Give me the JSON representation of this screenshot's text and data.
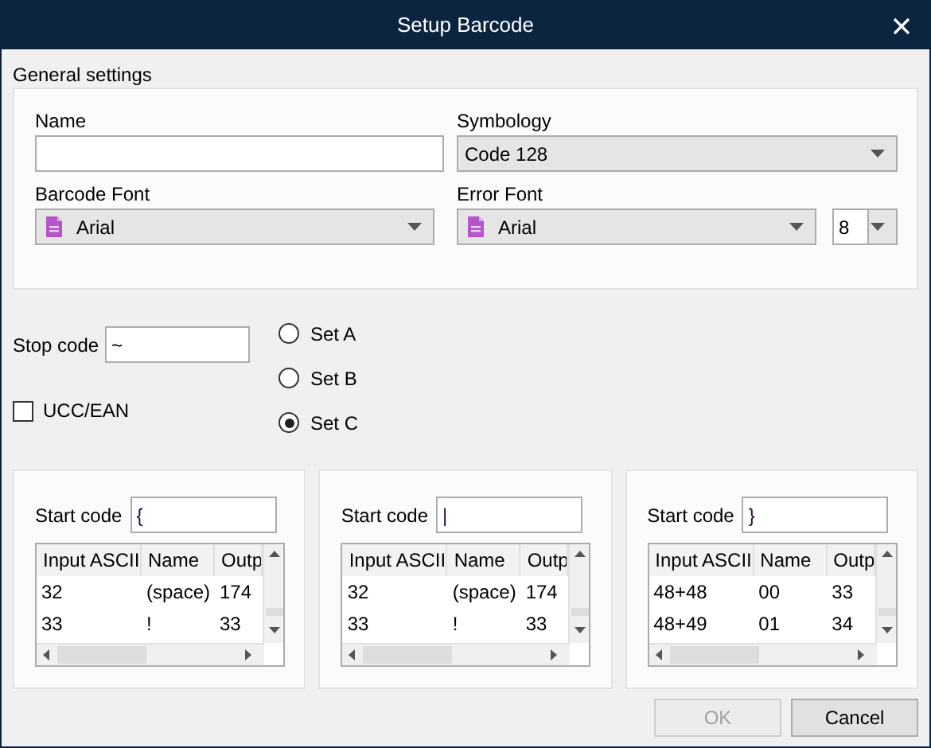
{
  "window": {
    "title": "Setup Barcode"
  },
  "general_settings": {
    "title": "General settings",
    "name": {
      "label": "Name"
    },
    "symbology": {
      "label": "Symbology",
      "value": "Code 128"
    },
    "barcode_font": {
      "label": "Barcode Font",
      "value": "Arial"
    },
    "error_font": {
      "label": "Error Font",
      "value": "Arial",
      "size": "8"
    }
  },
  "stop_code": {
    "label": "Stop code",
    "value": "~"
  },
  "sets": [
    {
      "label": "Set A",
      "selected": false
    },
    {
      "label": "Set B",
      "selected": false
    },
    {
      "label": "Set C",
      "selected": true
    }
  ],
  "ucc_ean": {
    "label": "UCC/EAN",
    "checked": false
  },
  "code_tables": [
    {
      "start_code_label": "Start code",
      "start_code": "{",
      "columns": [
        "Input ASCII",
        "Name",
        "Outp"
      ],
      "rows": [
        [
          "32",
          "(space)",
          "174"
        ],
        [
          "33",
          "!",
          "33"
        ]
      ]
    },
    {
      "start_code_label": "Start code",
      "start_code": "|",
      "columns": [
        "Input ASCII",
        "Name",
        "Outp"
      ],
      "rows": [
        [
          "32",
          "(space)",
          "174"
        ],
        [
          "33",
          "!",
          "33"
        ]
      ]
    },
    {
      "start_code_label": "Start code",
      "start_code": "}",
      "columns": [
        "Input ASCII",
        "Name",
        "Outp"
      ],
      "rows": [
        [
          "48+48",
          "00",
          "33"
        ],
        [
          "48+49",
          "01",
          "34"
        ]
      ]
    }
  ],
  "buttons": [
    {
      "label": "OK",
      "disabled": true
    },
    {
      "label": "Cancel",
      "disabled": false
    }
  ]
}
